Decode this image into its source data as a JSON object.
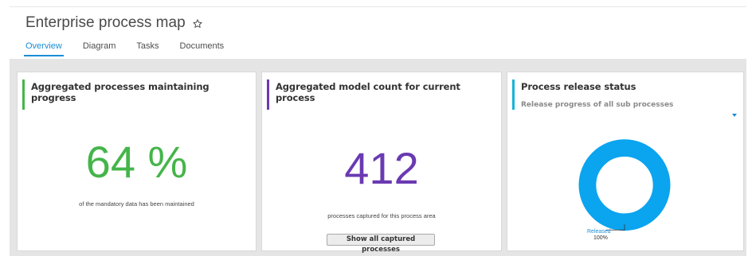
{
  "header": {
    "title": "Enterprise process map"
  },
  "tabs": [
    {
      "label": "Overview",
      "active": true
    },
    {
      "label": "Diagram",
      "active": false
    },
    {
      "label": "Tasks",
      "active": false
    },
    {
      "label": "Documents",
      "active": false
    }
  ],
  "cards": {
    "maintaining": {
      "title": "Aggregated processes maintaining progress",
      "value": "64 %",
      "caption": "of the mandatory data has been maintained",
      "accent_color": "#45b54a"
    },
    "model_count": {
      "title": "Aggregated model count for current process",
      "value": "412",
      "caption": "processes captured for this process area",
      "button_label": "Show all captured processes",
      "accent_color": "#6a3ab2"
    },
    "release_status": {
      "title": "Process release status",
      "subtitle": "Release progress of all sub processes",
      "accent_color": "#17b3d9",
      "chart_label": "Released",
      "chart_value": "100%"
    }
  },
  "chart_data": {
    "type": "pie",
    "categories": [
      "Released"
    ],
    "values": [
      100
    ],
    "colors": [
      "#0aa4ef"
    ],
    "donut": true
  },
  "colors": {
    "tab_active": "#1a8dd6",
    "content_background": "#e5e5e5"
  }
}
